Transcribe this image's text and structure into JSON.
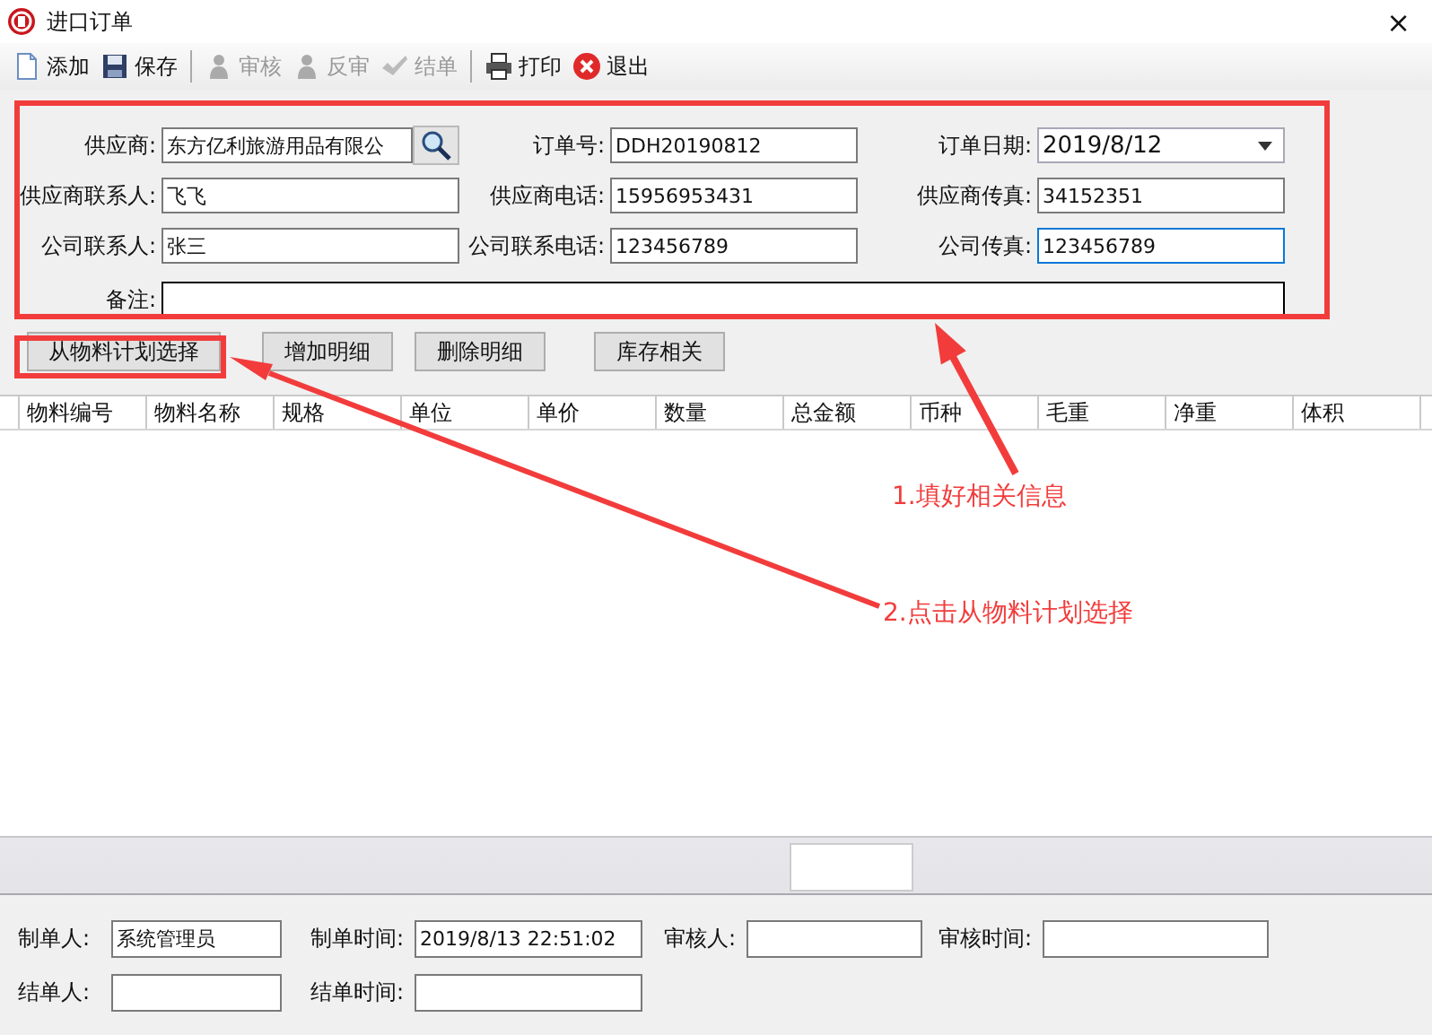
{
  "window": {
    "title": "进口订单",
    "close": "×"
  },
  "toolbar": [
    {
      "label": "添加",
      "kind": "document",
      "disabled": false
    },
    {
      "label": "保存",
      "kind": "floppy",
      "disabled": false
    },
    {
      "label": "审核",
      "kind": "person",
      "disabled": true
    },
    {
      "label": "反审",
      "kind": "person",
      "disabled": true
    },
    {
      "label": "结单",
      "kind": "check",
      "disabled": true
    },
    {
      "label": "打印",
      "kind": "printer",
      "disabled": false
    },
    {
      "label": "退出",
      "kind": "exit",
      "disabled": false
    }
  ],
  "form": {
    "rows": [
      [
        {
          "label": "供应商:",
          "value": "东方亿利旅游用品有限公",
          "kind": "lookup",
          "focused": false
        },
        {
          "label": "订单号:",
          "value": "DDH20190812",
          "kind": "text",
          "focused": false
        },
        {
          "label": "订单日期:",
          "value": "2019/8/12",
          "kind": "date",
          "focused": false
        }
      ],
      [
        {
          "label": "供应商联系人:",
          "value": "飞飞",
          "kind": "text",
          "focused": false
        },
        {
          "label": "供应商电话:",
          "value": "15956953431",
          "kind": "text",
          "focused": false
        },
        {
          "label": "供应商传真:",
          "value": "34152351",
          "kind": "text",
          "focused": false
        }
      ],
      [
        {
          "label": "公司联系人:",
          "value": "张三",
          "kind": "text",
          "focused": false
        },
        {
          "label": "公司联系电话:",
          "value": "123456789",
          "kind": "text",
          "focused": false
        },
        {
          "label": "公司传真:",
          "value": "123456789",
          "kind": "text",
          "focused": true
        }
      ]
    ],
    "note": {
      "label": "备注:"
    }
  },
  "buttons": [
    "从物料计划选择",
    "增加明细",
    "删除明细",
    "库存相关"
  ],
  "table": {
    "columns": [
      "物料编号",
      "物料名称",
      "规格",
      "单位",
      "单价",
      "数量",
      "总金额",
      "币种",
      "毛重",
      "净重",
      "体积"
    ]
  },
  "footer": {
    "rows": [
      [
        {
          "label": "制单人:",
          "value": "系统管理员"
        },
        {
          "label": "制单时间:",
          "value": "2019/8/13 22:51:02"
        },
        {
          "label": "审核人:"
        },
        {
          "label": "审核时间:"
        }
      ],
      [
        {
          "label": "结单人:"
        },
        {
          "label": "结单时间:"
        }
      ]
    ]
  },
  "annotations": [
    "1.填好相关信息",
    "2.点击从物料计划选择"
  ]
}
